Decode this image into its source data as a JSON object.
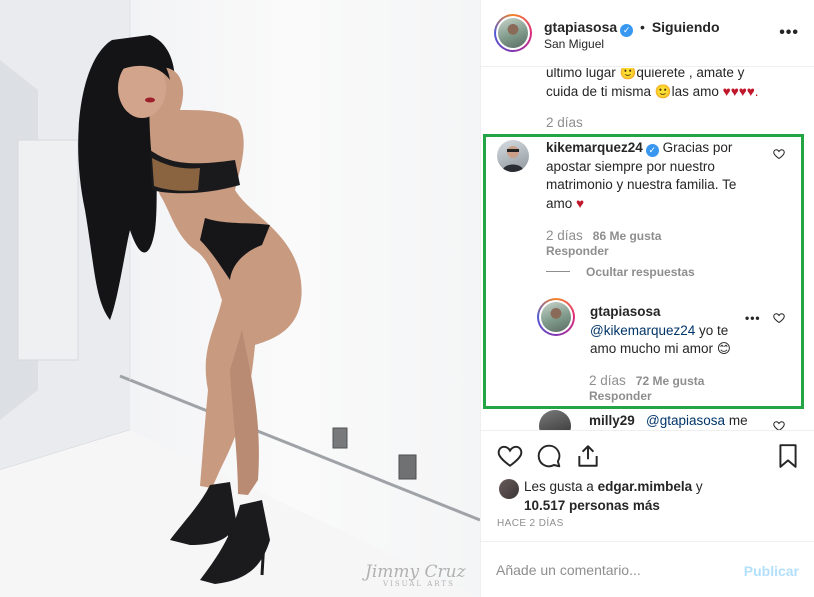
{
  "post": {
    "username": "gtapiasosa",
    "follow_status": "Siguiendo",
    "location": "San Miguel",
    "more_icon": "more-horizontal-icon"
  },
  "photo": {
    "watermark": "Jimmy Cruz",
    "watermark_sub": "VISUAL ARTS"
  },
  "comments": {
    "prev_line1": "ultimo lugar",
    "prev_line1b": "quierete , amate y",
    "prev_line2a": "cuida de ti misma",
    "prev_line2b": "las amo",
    "prev_hearts": "♥♥♥♥.",
    "prev_time": "2 días",
    "main": {
      "username": "kikemarquez24",
      "line1": "Gracias por",
      "line2": "apostar siempre por nuestro",
      "line3": "matrimonio y nuestra familia. Te",
      "line4": "amo",
      "heart": "♥",
      "time": "2 días",
      "likes": "86 Me gusta",
      "reply": "Responder"
    },
    "hide_replies": "Ocultar respuestas",
    "reply": {
      "username": "gtapiasosa",
      "mention": "@kikemarquez24",
      "line1": "yo te",
      "line2": "amo mucho mi amor",
      "time": "2 días",
      "likes": "72 Me gusta",
      "reply": "Responder"
    },
    "next": {
      "username": "milly29",
      "mention": "@gtapiasosa",
      "text": "me"
    }
  },
  "likes": {
    "prefix": "Les gusta a",
    "user": "edgar.mimbela",
    "connector": "y",
    "count": "10.517 personas más"
  },
  "date": "HACE 2 DÍAS",
  "add_comment": {
    "placeholder": "Añade un comentario...",
    "publish": "Publicar"
  },
  "colors": {
    "highlight_box": "#23a445",
    "verified": "#3897f0",
    "link": "#003569",
    "muted": "#8e8e8e"
  }
}
